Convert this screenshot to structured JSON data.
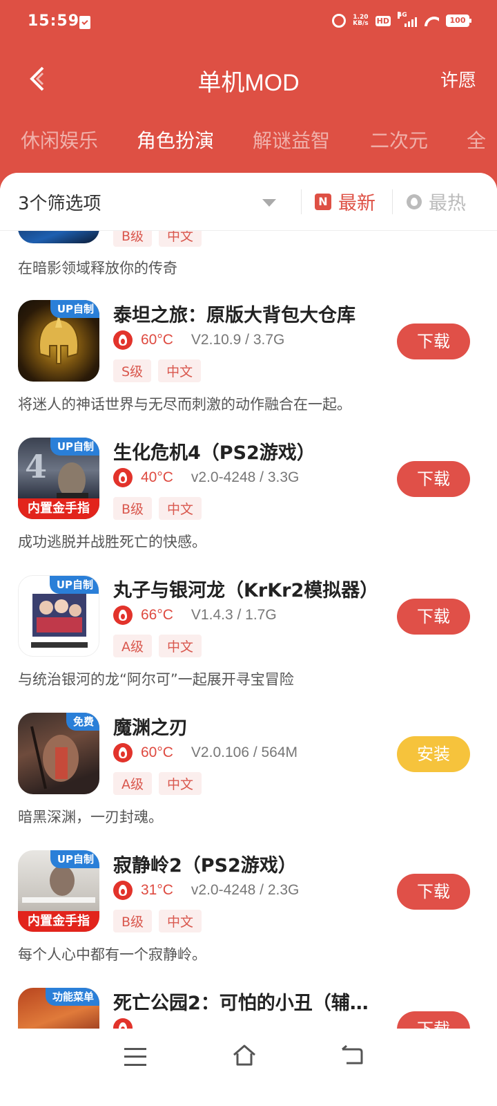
{
  "status_bar": {
    "time": "15:59",
    "speed_top": "1.20",
    "speed_unit": "KB/s",
    "hd": "HD",
    "network": "4G",
    "battery": "100"
  },
  "topbar": {
    "title": "单机MOD",
    "wish": "许愿"
  },
  "tabs": [
    "休闲娱乐",
    "角色扮演",
    "解谜益智",
    "二次元",
    "全"
  ],
  "active_tab": 1,
  "filter": {
    "label": "3个筛选项",
    "sort_new": "最新",
    "sort_new_icon": "N",
    "sort_hot": "最热"
  },
  "partial_item": {
    "tags": [
      "B级",
      "中文"
    ],
    "desc": "在暗影领域释放你的传奇"
  },
  "items": [
    {
      "badge": "UP自制",
      "cheat": "",
      "name": "泰坦之旅：原版大背包大仓库",
      "temp": "60°C",
      "version": "V2.10.9 / 3.7G",
      "tags": [
        "S级",
        "中文"
      ],
      "desc": "将迷人的神话世界与无尽而刺激的动作融合在一起。",
      "button": "下载"
    },
    {
      "badge": "UP自制",
      "cheat": "内置金手指",
      "name": "生化危机4（PS2游戏）",
      "temp": "40°C",
      "version": "v2.0-4248 / 3.3G",
      "tags": [
        "B级",
        "中文"
      ],
      "desc": "成功逃脱并战胜死亡的快感。",
      "button": "下载"
    },
    {
      "badge": "UP自制",
      "cheat": "",
      "name": "丸子与银河龙（KrKr2模拟器）",
      "temp": "66°C",
      "version": "V1.4.3 / 1.7G",
      "tags": [
        "A级",
        "中文"
      ],
      "desc": "与统治银河的龙“阿尔可”一起展开寻宝冒险",
      "button": "下载"
    },
    {
      "badge": "免费",
      "cheat": "",
      "name": "魔渊之刃",
      "temp": "60°C",
      "version": "V2.0.106 / 564M",
      "tags": [
        "A级",
        "中文"
      ],
      "desc": "暗黑深渊，一刃封魂。",
      "button": "安装"
    },
    {
      "badge": "UP自制",
      "cheat": "内置金手指",
      "name": "寂静岭2（PS2游戏）",
      "temp": "31°C",
      "version": "v2.0-4248 / 2.3G",
      "tags": [
        "B级",
        "中文"
      ],
      "desc": "每个人心中都有一个寂静岭。",
      "button": "下载"
    },
    {
      "badge": "功能菜单",
      "cheat": "",
      "name": "死亡公园2：可怕的小丑（辅…",
      "temp": "",
      "version": "",
      "tags": [],
      "desc": "",
      "button": "下载"
    }
  ],
  "icon_art": {
    "item0": "titan-quest-helmet-icon",
    "item1": "resident-evil-4-cover",
    "item2": "marco-galaxy-dragon-cover",
    "item3": "blade-of-abyss-knight",
    "item4": "silent-hill-2-cover",
    "item5": "dead-park-2-cover"
  },
  "colors": {
    "brand_red": "#de5044",
    "button_red": "#e05048",
    "install_yellow": "#f6c33c",
    "badge_blue": "#2a7fd8"
  }
}
